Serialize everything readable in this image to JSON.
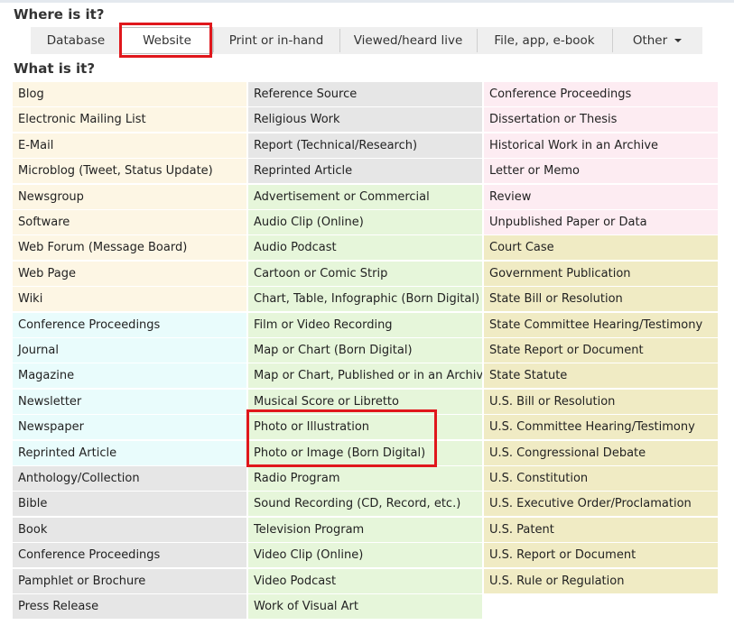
{
  "where_heading": "Where is it?",
  "what_heading": "What is it?",
  "tabs": [
    {
      "label": "Database",
      "width": 100
    },
    {
      "label": "Website",
      "width": 102,
      "active": true
    },
    {
      "label": "Print or in-hand",
      "width": 140
    },
    {
      "label": "Viewed/heard live",
      "width": 152
    },
    {
      "label": "File, app, e-book",
      "width": 150
    },
    {
      "label": "Other",
      "width": 100,
      "dropdown": true
    }
  ],
  "columns": [
    [
      {
        "label": "Blog",
        "color": "tan"
      },
      {
        "label": "Electronic Mailing List",
        "color": "tan"
      },
      {
        "label": "E-Mail",
        "color": "tan"
      },
      {
        "label": "Microblog (Tweet, Status Update)",
        "color": "tan"
      },
      {
        "label": "Newsgroup",
        "color": "tan"
      },
      {
        "label": "Software",
        "color": "tan"
      },
      {
        "label": "Web Forum (Message Board)",
        "color": "tan"
      },
      {
        "label": "Web Page",
        "color": "tan"
      },
      {
        "label": "Wiki",
        "color": "tan"
      },
      {
        "label": "Conference Proceedings",
        "color": "cyan"
      },
      {
        "label": "Journal",
        "color": "cyan"
      },
      {
        "label": "Magazine",
        "color": "cyan"
      },
      {
        "label": "Newsletter",
        "color": "cyan"
      },
      {
        "label": "Newspaper",
        "color": "cyan"
      },
      {
        "label": "Reprinted Article",
        "color": "cyan"
      },
      {
        "label": "Anthology/Collection",
        "color": "gray"
      },
      {
        "label": "Bible",
        "color": "gray"
      },
      {
        "label": "Book",
        "color": "gray"
      },
      {
        "label": "Conference Proceedings",
        "color": "gray"
      },
      {
        "label": "Pamphlet or Brochure",
        "color": "gray"
      },
      {
        "label": "Press Release",
        "color": "gray"
      }
    ],
    [
      {
        "label": "Reference Source",
        "color": "gray"
      },
      {
        "label": "Religious Work",
        "color": "gray"
      },
      {
        "label": "Report (Technical/Research)",
        "color": "gray"
      },
      {
        "label": "Reprinted Article",
        "color": "gray"
      },
      {
        "label": "Advertisement or Commercial",
        "color": "green"
      },
      {
        "label": "Audio Clip (Online)",
        "color": "green"
      },
      {
        "label": "Audio Podcast",
        "color": "green"
      },
      {
        "label": "Cartoon or Comic Strip",
        "color": "green"
      },
      {
        "label": "Chart, Table, Infographic (Born Digital)",
        "color": "green"
      },
      {
        "label": "Film or Video Recording",
        "color": "green"
      },
      {
        "label": "Map or Chart (Born Digital)",
        "color": "green"
      },
      {
        "label": "Map or Chart, Published or in an Archive",
        "color": "green"
      },
      {
        "label": "Musical Score or Libretto",
        "color": "green"
      },
      {
        "label": "Photo or Illustration",
        "color": "green"
      },
      {
        "label": "Photo or Image (Born Digital)",
        "color": "green"
      },
      {
        "label": "Radio Program",
        "color": "green"
      },
      {
        "label": "Sound Recording (CD, Record, etc.)",
        "color": "green"
      },
      {
        "label": "Television Program",
        "color": "green"
      },
      {
        "label": "Video Clip (Online)",
        "color": "green"
      },
      {
        "label": "Video Podcast",
        "color": "green"
      },
      {
        "label": "Work of Visual Art",
        "color": "green"
      }
    ],
    [
      {
        "label": "Conference Proceedings",
        "color": "pink"
      },
      {
        "label": "Dissertation or Thesis",
        "color": "pink"
      },
      {
        "label": "Historical Work in an Archive",
        "color": "pink"
      },
      {
        "label": "Letter or Memo",
        "color": "pink"
      },
      {
        "label": "Review",
        "color": "pink"
      },
      {
        "label": "Unpublished Paper or Data",
        "color": "pink"
      },
      {
        "label": "Court Case",
        "color": "khaki"
      },
      {
        "label": "Government Publication",
        "color": "khaki"
      },
      {
        "label": "State Bill or Resolution",
        "color": "khaki"
      },
      {
        "label": "State Committee Hearing/Testimony",
        "color": "khaki"
      },
      {
        "label": "State Report or Document",
        "color": "khaki"
      },
      {
        "label": "State Statute",
        "color": "khaki"
      },
      {
        "label": "U.S. Bill or Resolution",
        "color": "khaki"
      },
      {
        "label": "U.S. Committee Hearing/Testimony",
        "color": "khaki"
      },
      {
        "label": "U.S. Congressional Debate",
        "color": "khaki"
      },
      {
        "label": "U.S. Constitution",
        "color": "khaki"
      },
      {
        "label": "U.S. Executive Order/Proclamation",
        "color": "khaki"
      },
      {
        "label": "U.S. Patent",
        "color": "khaki"
      },
      {
        "label": "U.S. Report or Document",
        "color": "khaki"
      },
      {
        "label": "U.S. Rule or Regulation",
        "color": "khaki"
      }
    ]
  ],
  "colors": {
    "tan": "#fdf6e4",
    "cyan": "#e9fcfc",
    "gray": "#e6e6e6",
    "green": "#e6f6da",
    "pink": "#fdecf2",
    "khaki": "#f0ebc4",
    "highlight": "#e0171c"
  }
}
